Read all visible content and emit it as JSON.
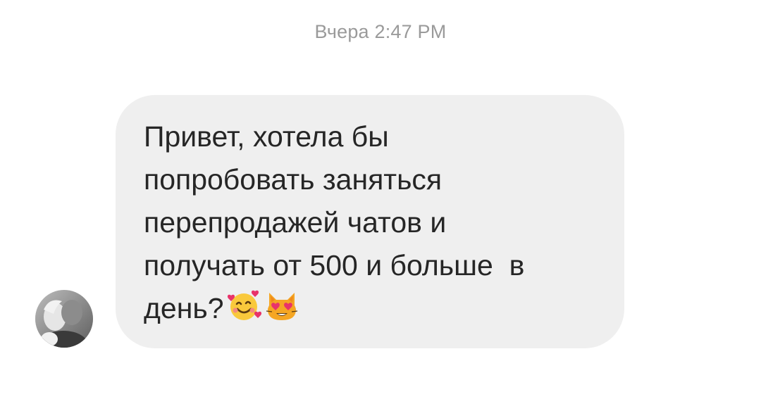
{
  "conversation": {
    "timestamp": "Вчера 2:47 PM",
    "message": {
      "lines": [
        "Привет, хотела бы",
        "попробовать заняться",
        "перепродажей чатов и",
        "получать от 500 и больше  в",
        "день?"
      ],
      "emojis": [
        "smiling-face-with-hearts-icon",
        "heart-eyes-cat-icon"
      ]
    },
    "sender": {
      "avatar_icon": "profile-photo-avatar"
    }
  },
  "colors": {
    "background": "#ffffff",
    "bubble": "#efefef",
    "message_text": "#262626",
    "timestamp_text": "#9a9a9a"
  }
}
